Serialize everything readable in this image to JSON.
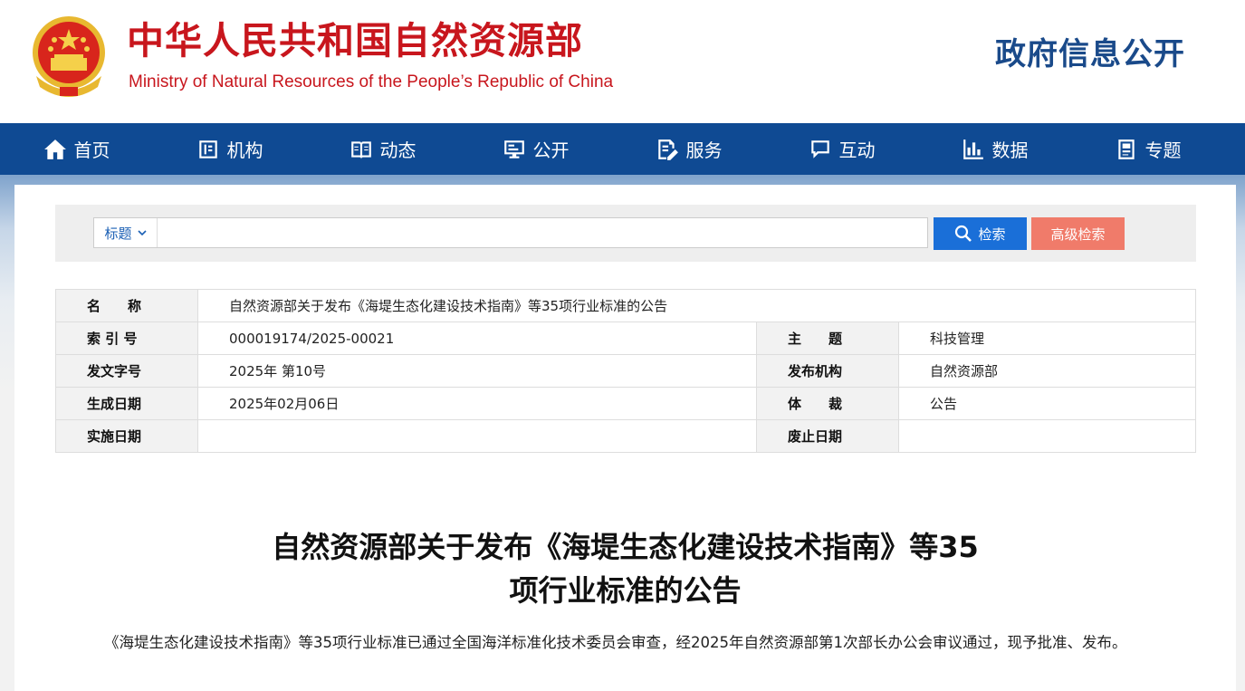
{
  "header": {
    "site_name_cn": "中华人民共和国自然资源部",
    "site_name_en": "Ministry of Natural Resources of the People’s Republic of China",
    "section": "政府信息公开",
    "colors": {
      "brand_red": "#c8161d",
      "nav_blue": "#0f4a93"
    }
  },
  "nav": {
    "items": [
      {
        "label": "首页",
        "icon": "home-icon"
      },
      {
        "label": "机构",
        "icon": "org-icon"
      },
      {
        "label": "动态",
        "icon": "book-icon"
      },
      {
        "label": "公开",
        "icon": "monitor-icon"
      },
      {
        "label": "服务",
        "icon": "edit-doc-icon"
      },
      {
        "label": "互动",
        "icon": "chat-icon"
      },
      {
        "label": "数据",
        "icon": "bar-chart-icon"
      },
      {
        "label": "专题",
        "icon": "topic-icon"
      }
    ]
  },
  "search": {
    "type_label": "标题",
    "placeholder": "",
    "value": "",
    "search_button": "检索",
    "advanced_button": "高级检索"
  },
  "meta": {
    "name_label": "名　　称",
    "name_value": "自然资源部关于发布《海堤生态化建设技术指南》等35项行业标准的公告",
    "index_label": "索 引 号",
    "index_value": "000019174/2025-00021",
    "topic_label": "主　　题",
    "topic_value": "科技管理",
    "doc_no_label": "发文字号",
    "doc_no_value": "2025年 第10号",
    "issuer_label": "发布机构",
    "issuer_value": "自然资源部",
    "date_label": "生成日期",
    "date_value": "2025年02月06日",
    "genre_label": "体　　裁",
    "genre_value": "公告",
    "effective_label": "实施日期",
    "effective_value": "",
    "abolish_label": "废止日期",
    "abolish_value": ""
  },
  "article": {
    "title_line1": "自然资源部关于发布《海堤生态化建设技术指南》等35",
    "title_line2": "项行业标准的公告",
    "paragraph1": "《海堤生态化建设技术指南》等35项行业标准已通过全国海洋标准化技术委员会审查，经2025年自然资源部第1次部长办公会审议通过，现予批准、发布。"
  }
}
